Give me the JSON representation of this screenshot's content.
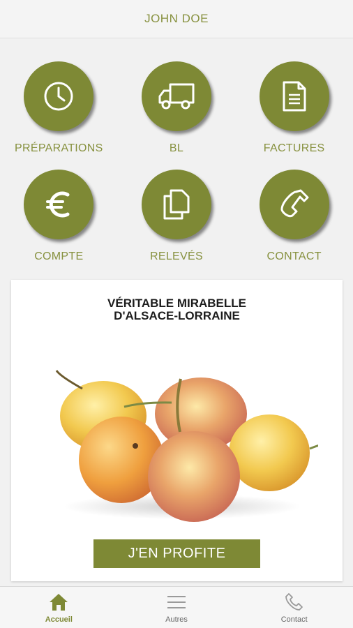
{
  "header": {
    "title": "JOHN DOE"
  },
  "tiles": [
    {
      "label": "PRÉPARATIONS",
      "icon": "clock-icon"
    },
    {
      "label": "BL",
      "icon": "truck-icon"
    },
    {
      "label": "FACTURES",
      "icon": "document-icon"
    },
    {
      "label": "COMPTE",
      "icon": "euro-icon"
    },
    {
      "label": "RELEVÉS",
      "icon": "copy-icon"
    },
    {
      "label": "CONTACT",
      "icon": "phone-icon"
    }
  ],
  "promo": {
    "title_line1": "VÉRITABLE MIRABELLE",
    "title_line2": "D'ALSACE-LORRAINE",
    "image": "mirabelle-plums-image",
    "button_label": "J'EN PROFITE"
  },
  "bottom_nav": [
    {
      "label": "Accueil",
      "icon": "home-icon",
      "active": true
    },
    {
      "label": "Autres",
      "icon": "menu-icon",
      "active": false
    },
    {
      "label": "Contact",
      "icon": "phone-icon",
      "active": false
    }
  ],
  "colors": {
    "accent": "#7e8935",
    "accent_text": "#87913f",
    "background": "#f1f1f1"
  }
}
